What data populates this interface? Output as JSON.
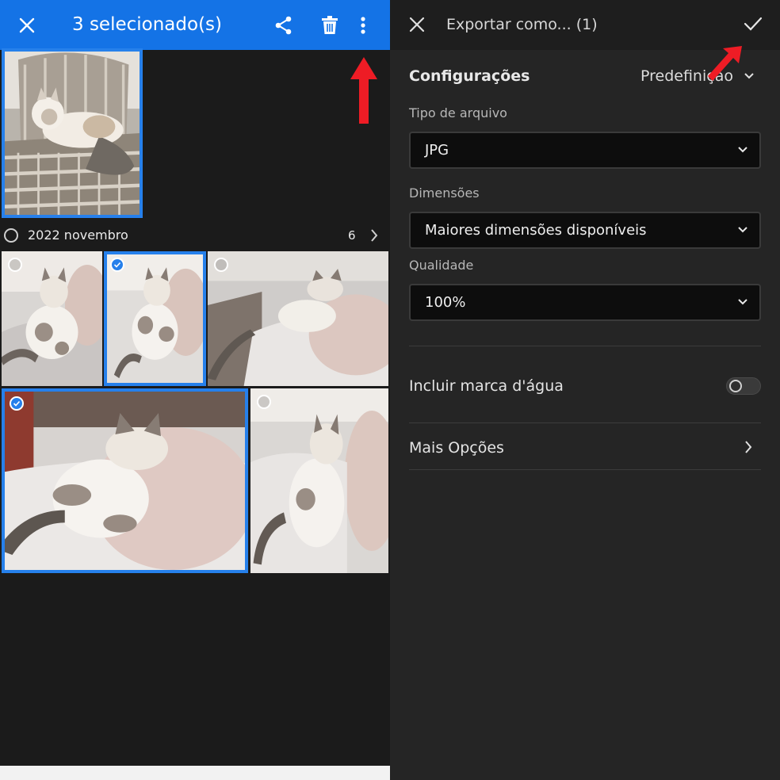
{
  "left_panel": {
    "header": {
      "title": "3 selecionado(s)",
      "background": "#1473e6",
      "icons": [
        "close-icon",
        "share-icon",
        "trash-icon",
        "more-vertical-icon"
      ]
    },
    "group": {
      "label": "2022 novembro",
      "count": "6"
    },
    "selection_color": "#2680eb"
  },
  "right_panel": {
    "header": {
      "title": "Exportar como... (1)",
      "icons": [
        "close-icon",
        "checkmark-icon"
      ]
    },
    "settings": {
      "label": "Configurações",
      "preset": "Predefinição"
    },
    "file_type": {
      "label": "Tipo de arquivo",
      "value": "JPG"
    },
    "dimensions": {
      "label": "Dimensões",
      "value": "Maiores dimensões disponíveis"
    },
    "quality": {
      "label": "Qualidade",
      "value": "100%"
    },
    "watermark": {
      "label": "Incluir marca d'água",
      "enabled": false
    },
    "more_options": {
      "label": "Mais Opções"
    }
  },
  "annotation_color": "#ee1c25"
}
